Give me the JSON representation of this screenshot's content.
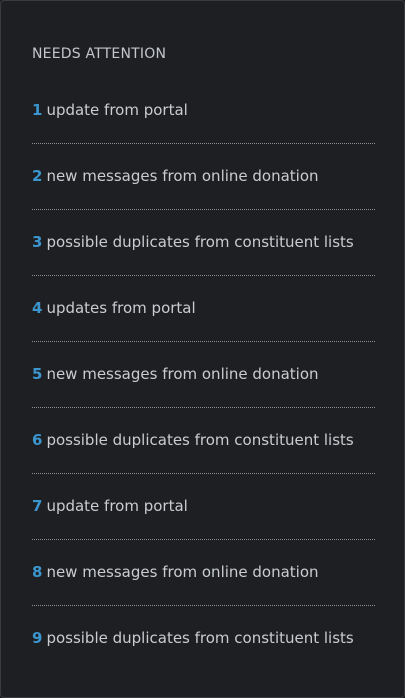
{
  "panel": {
    "heading": "NEEDS ATTENTION",
    "items": [
      {
        "count": "1",
        "text": "update from portal"
      },
      {
        "count": "2",
        "text": "new messages from online donation"
      },
      {
        "count": "3",
        "text": "possible duplicates from constituent lists"
      },
      {
        "count": "4",
        "text": "updates from portal"
      },
      {
        "count": "5",
        "text": "new messages from online donation"
      },
      {
        "count": "6",
        "text": "possible duplicates from constituent lists"
      },
      {
        "count": "7",
        "text": "update from portal"
      },
      {
        "count": "8",
        "text": "new messages from online donation"
      },
      {
        "count": "9",
        "text": "possible duplicates from constituent lists"
      }
    ]
  },
  "colors": {
    "background": "#1e1f22",
    "accent": "#3b96cf",
    "text": "#c9ccd0",
    "divider": "#8d9096"
  }
}
